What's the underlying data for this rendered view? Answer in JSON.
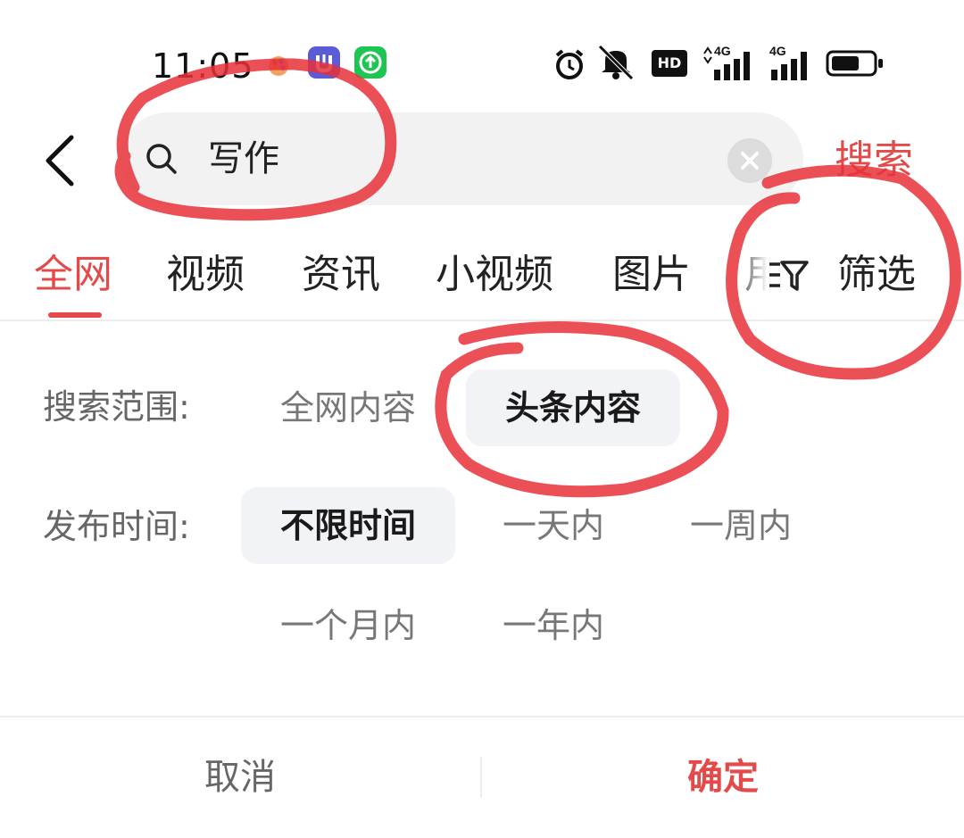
{
  "status_bar": {
    "time": "11:05",
    "hd_label": "HD",
    "network_1": "4G",
    "network_2": "4G"
  },
  "search": {
    "query": "写作",
    "action_label": "搜索"
  },
  "tabs": [
    {
      "label": "全网",
      "active": true
    },
    {
      "label": "视频",
      "active": false
    },
    {
      "label": "资讯",
      "active": false
    },
    {
      "label": "小视频",
      "active": false
    },
    {
      "label": "图片",
      "active": false
    },
    {
      "label": "用",
      "active": false
    }
  ],
  "filter": {
    "label": "筛选"
  },
  "panel": {
    "scope": {
      "label": "搜索范围:",
      "options": [
        {
          "label": "全网内容",
          "selected": false
        },
        {
          "label": "头条内容",
          "selected": true
        }
      ]
    },
    "time": {
      "label": "发布时间:",
      "options": [
        {
          "label": "不限时间",
          "selected": true
        },
        {
          "label": "一天内",
          "selected": false
        },
        {
          "label": "一周内",
          "selected": false
        },
        {
          "label": "一个月内",
          "selected": false
        },
        {
          "label": "一年内",
          "selected": false
        }
      ]
    }
  },
  "actions": {
    "cancel": "取消",
    "confirm": "确定"
  },
  "colors": {
    "accent": "#e34b4b",
    "selected_bg": "#f1f3f6",
    "annotation": "#e8313a"
  }
}
